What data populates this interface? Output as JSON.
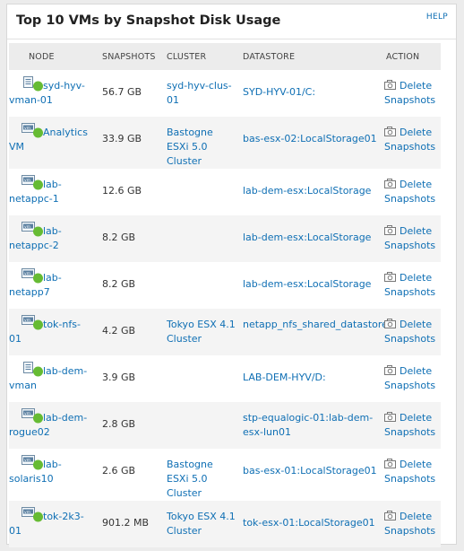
{
  "title": "Top 10 VMs by Snapshot Disk Usage",
  "help_label": "HELP",
  "columns": [
    "NODE",
    "SNAPSHOTS",
    "CLUSTER",
    "DATASTORE",
    "ACTION"
  ],
  "action_label": "Delete Snapshots",
  "colors": {
    "link": "#0f6fb4",
    "status_up": "#66bb33",
    "header_bg": "#ececec"
  },
  "rows": [
    {
      "node": "syd-hyv-vman-01",
      "icon": "hyperv-vm-icon",
      "snapshots": "56.7 GB",
      "cluster": "syd-hyv-clus-01",
      "datastore": "SYD-HYV-01/C:"
    },
    {
      "node": "Analytics VM",
      "icon": "vmware-vm-icon",
      "snapshots": "33.9 GB",
      "cluster": "Bastogne ESXi 5.0 Cluster",
      "datastore": "bas-esx-02:LocalStorage01"
    },
    {
      "node": "lab-netappc-1",
      "icon": "vmware-vm-icon",
      "snapshots": "12.6 GB",
      "cluster": "",
      "datastore": "lab-dem-esx:LocalStorage"
    },
    {
      "node": "lab-netappc-2",
      "icon": "vmware-vm-icon",
      "snapshots": "8.2 GB",
      "cluster": "",
      "datastore": "lab-dem-esx:LocalStorage"
    },
    {
      "node": "lab-netapp7",
      "icon": "vmware-vm-icon",
      "snapshots": "8.2 GB",
      "cluster": "",
      "datastore": "lab-dem-esx:LocalStorage"
    },
    {
      "node": "tok-nfs-01",
      "icon": "vmware-vm-icon",
      "snapshots": "4.2 GB",
      "cluster": "Tokyo ESX 4.1 Cluster",
      "datastore": "netapp_nfs_shared_datastore"
    },
    {
      "node": "lab-dem-vman",
      "icon": "hyperv-vm-icon",
      "snapshots": "3.9 GB",
      "cluster": "",
      "datastore": "LAB-DEM-HYV/D:"
    },
    {
      "node": "lab-dem-rogue02",
      "icon": "vmware-vm-icon",
      "snapshots": "2.8 GB",
      "cluster": "",
      "datastore": "stp-equalogic-01:lab-dem-esx-lun01"
    },
    {
      "node": "lab-solaris10",
      "icon": "vmware-vm-icon",
      "snapshots": "2.6 GB",
      "cluster": "Bastogne ESXi 5.0 Cluster",
      "datastore": "bas-esx-01:LocalStorage01"
    },
    {
      "node": "tok-2k3-01",
      "icon": "vmware-vm-icon",
      "snapshots": "901.2 MB",
      "cluster": "Tokyo ESX 4.1 Cluster",
      "datastore": "tok-esx-01:LocalStorage01"
    }
  ]
}
